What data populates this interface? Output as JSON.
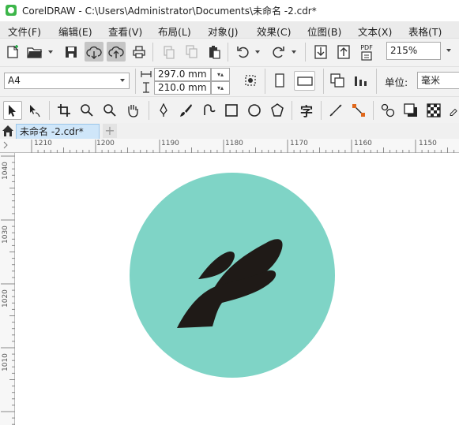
{
  "window": {
    "title": "CorelDRAW - C:\\Users\\Administrator\\Documents\\未命名 -2.cdr*"
  },
  "menu": [
    {
      "label": "文件(F)"
    },
    {
      "label": "编辑(E)"
    },
    {
      "label": "查看(V)"
    },
    {
      "label": "布局(L)"
    },
    {
      "label": "对象(J)"
    },
    {
      "label": "效果(C)"
    },
    {
      "label": "位图(B)"
    },
    {
      "label": "文本(X)"
    },
    {
      "label": "表格(T)"
    }
  ],
  "standard_toolbar": {
    "pdf_label": "PDF",
    "zoom_value": "215%"
  },
  "property_bar": {
    "page_size": "A4",
    "width": "297.0 mm",
    "height": "210.0 mm",
    "units_label": "单位:",
    "units_value": "毫米"
  },
  "toolbox": {
    "text_tool_glyph": "字"
  },
  "document_tab": {
    "label": "未命名 -2.cdr*",
    "add_glyph": "+"
  },
  "ruler": {
    "h_labels": [
      "1210",
      "1200",
      "1190",
      "1180",
      "1170",
      "1160",
      "1150"
    ],
    "v_labels": [
      "1040",
      "1030",
      "1020",
      "1010"
    ]
  },
  "artwork": {
    "circle_color": "#7fd4c6",
    "hand_color": "#1f1a17",
    "circle_outline": "none"
  }
}
